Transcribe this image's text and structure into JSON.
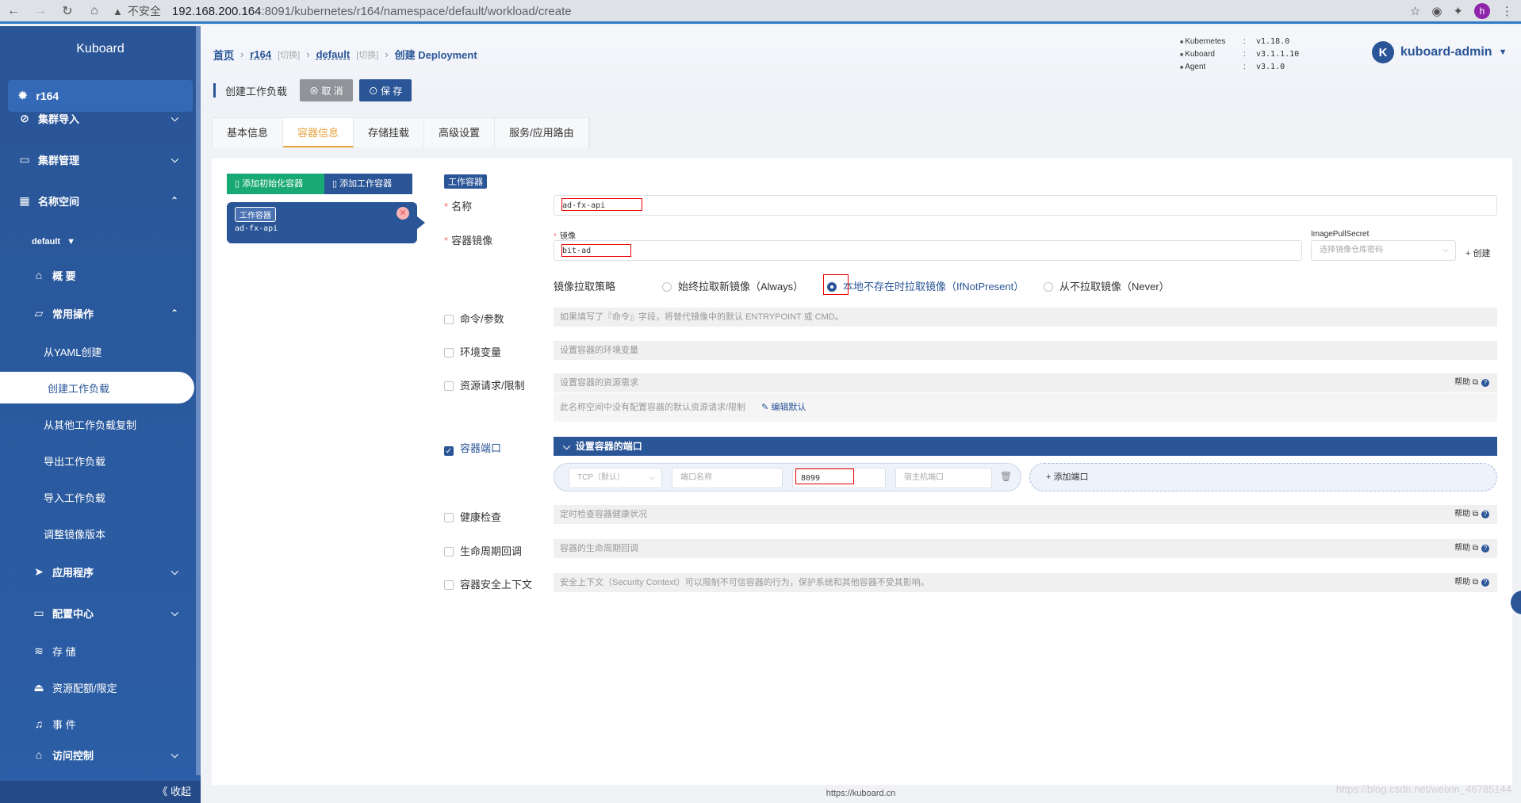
{
  "browser": {
    "insecure": "不安全",
    "host": "192.168.200.164",
    "path": ":8091/kubernetes/r164/namespace/default/workload/create",
    "profile": "h"
  },
  "sidebar": {
    "logo": "Kuboard",
    "cluster": "r164",
    "groups": [
      {
        "label": "集群导入"
      },
      {
        "label": "集群管理"
      },
      {
        "label": "名称空间"
      }
    ],
    "namespace": "default",
    "overview": "概 要",
    "common_ops": "常用操作",
    "ops_items": [
      "从YAML创建",
      "创建工作负载",
      "从其他工作负载复制",
      "导出工作负载",
      "导入工作负载",
      "调整镜像版本"
    ],
    "apps": "应用程序",
    "config": "配置中心",
    "storage": "存 储",
    "quota": "资源配额/限定",
    "events": "事 件",
    "access": "访问控制",
    "collapse": "《 收起"
  },
  "header": {
    "crumbs": {
      "home": "首页",
      "cluster": "r164",
      "switch1": "[切换]",
      "ns": "default",
      "switch2": "[切换]",
      "current": "创建 Deployment"
    },
    "versions": [
      {
        "k": "Kubernetes",
        "v": "v1.18.0"
      },
      {
        "k": "Kuboard",
        "v": "v3.1.1.10"
      },
      {
        "k": "Agent",
        "v": "v3.1.0"
      }
    ],
    "user": "kuboard-admin",
    "avatar": "K",
    "toolbar_title": "创建工作负载",
    "cancel": "⊗ 取 消",
    "save": "⊙ 保 存"
  },
  "tabs": [
    "基本信息",
    "容器信息",
    "存储挂载",
    "高级设置",
    "服务/应用路由"
  ],
  "containers": {
    "add_init": "添加初始化容器",
    "add_work": "添加工作容器",
    "card_badge": "工作容器",
    "card_name": "ad-fx-api"
  },
  "form": {
    "section_badge": "工作容器",
    "name_label": "名称",
    "name_value": "ad-fx-api",
    "image_label": "容器镜像",
    "image_sub": "镜像",
    "image_value": "bit-ad",
    "pull_secret_label": "ImagePullSecret",
    "pull_secret_placeholder": "选择镜像仓库密码",
    "create": "+ 创建",
    "pull_policy_label": "镜像拉取策略",
    "pull_options": [
      "始终拉取新镜像（Always）",
      "本地不存在时拉取镜像（IfNotPresent）",
      "从不拉取镜像（Never）"
    ],
    "cmd_label": "命令/参数",
    "cmd_hint": "如果填写了『命令』字段，将替代镜像中的默认 ENTRYPOINT 或 CMD。",
    "env_label": "环境变量",
    "env_hint": "设置容器的环境变量",
    "res_label": "资源请求/限制",
    "res_hint": "设置容器的资源需求",
    "res_note": "此名称空间中没有配置容器的默认资源请求/限制",
    "res_edit": "编辑默认",
    "help": "帮助",
    "port_label": "容器端口",
    "port_bar": "设置容器的端口",
    "protocol": "TCP（默认）",
    "port_name_ph": "端口名称",
    "port_value": "8099",
    "host_port_ph": "宿主机端口",
    "add_port": "+ 添加端口",
    "health_label": "健康检查",
    "health_hint": "定时检查容器健康状况",
    "life_label": "生命周期回调",
    "life_hint": "容器的生命周期回调",
    "sec_label": "容器安全上下文",
    "sec_hint": "安全上下文（Security Context）可以限制不可信容器的行为，保护系统和其他容器不受其影响。"
  },
  "footer": "https://kuboard.cn",
  "watermark": "https://blog.csdn.net/weixin_46785144"
}
